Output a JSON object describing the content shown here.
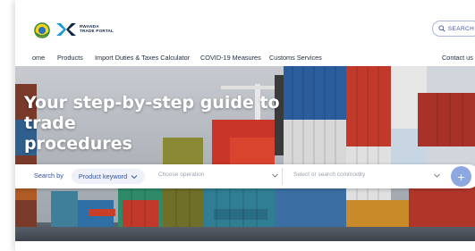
{
  "header": {
    "logo_text_line1": "RWANDA",
    "logo_text_line2": "TRADE PORTAL",
    "search_label": "SEARCH"
  },
  "nav": {
    "items": [
      "ome",
      "Products",
      "Import Duties & Taxes Calculator",
      "COVID-19 Measures",
      "Customs Services"
    ],
    "contact": "Contact us"
  },
  "hero": {
    "title_line1": "Your step-by-step guide to trade",
    "title_line2": "procedures"
  },
  "search_bar": {
    "label": "Search by",
    "mode": "Product keyword",
    "operation_placeholder": "Choose operation",
    "commodity_placeholder": "Select or search commodity",
    "go_symbol": "+"
  },
  "colors": {
    "accent": "#2f4fa0",
    "go_button": "#8da7e0"
  }
}
